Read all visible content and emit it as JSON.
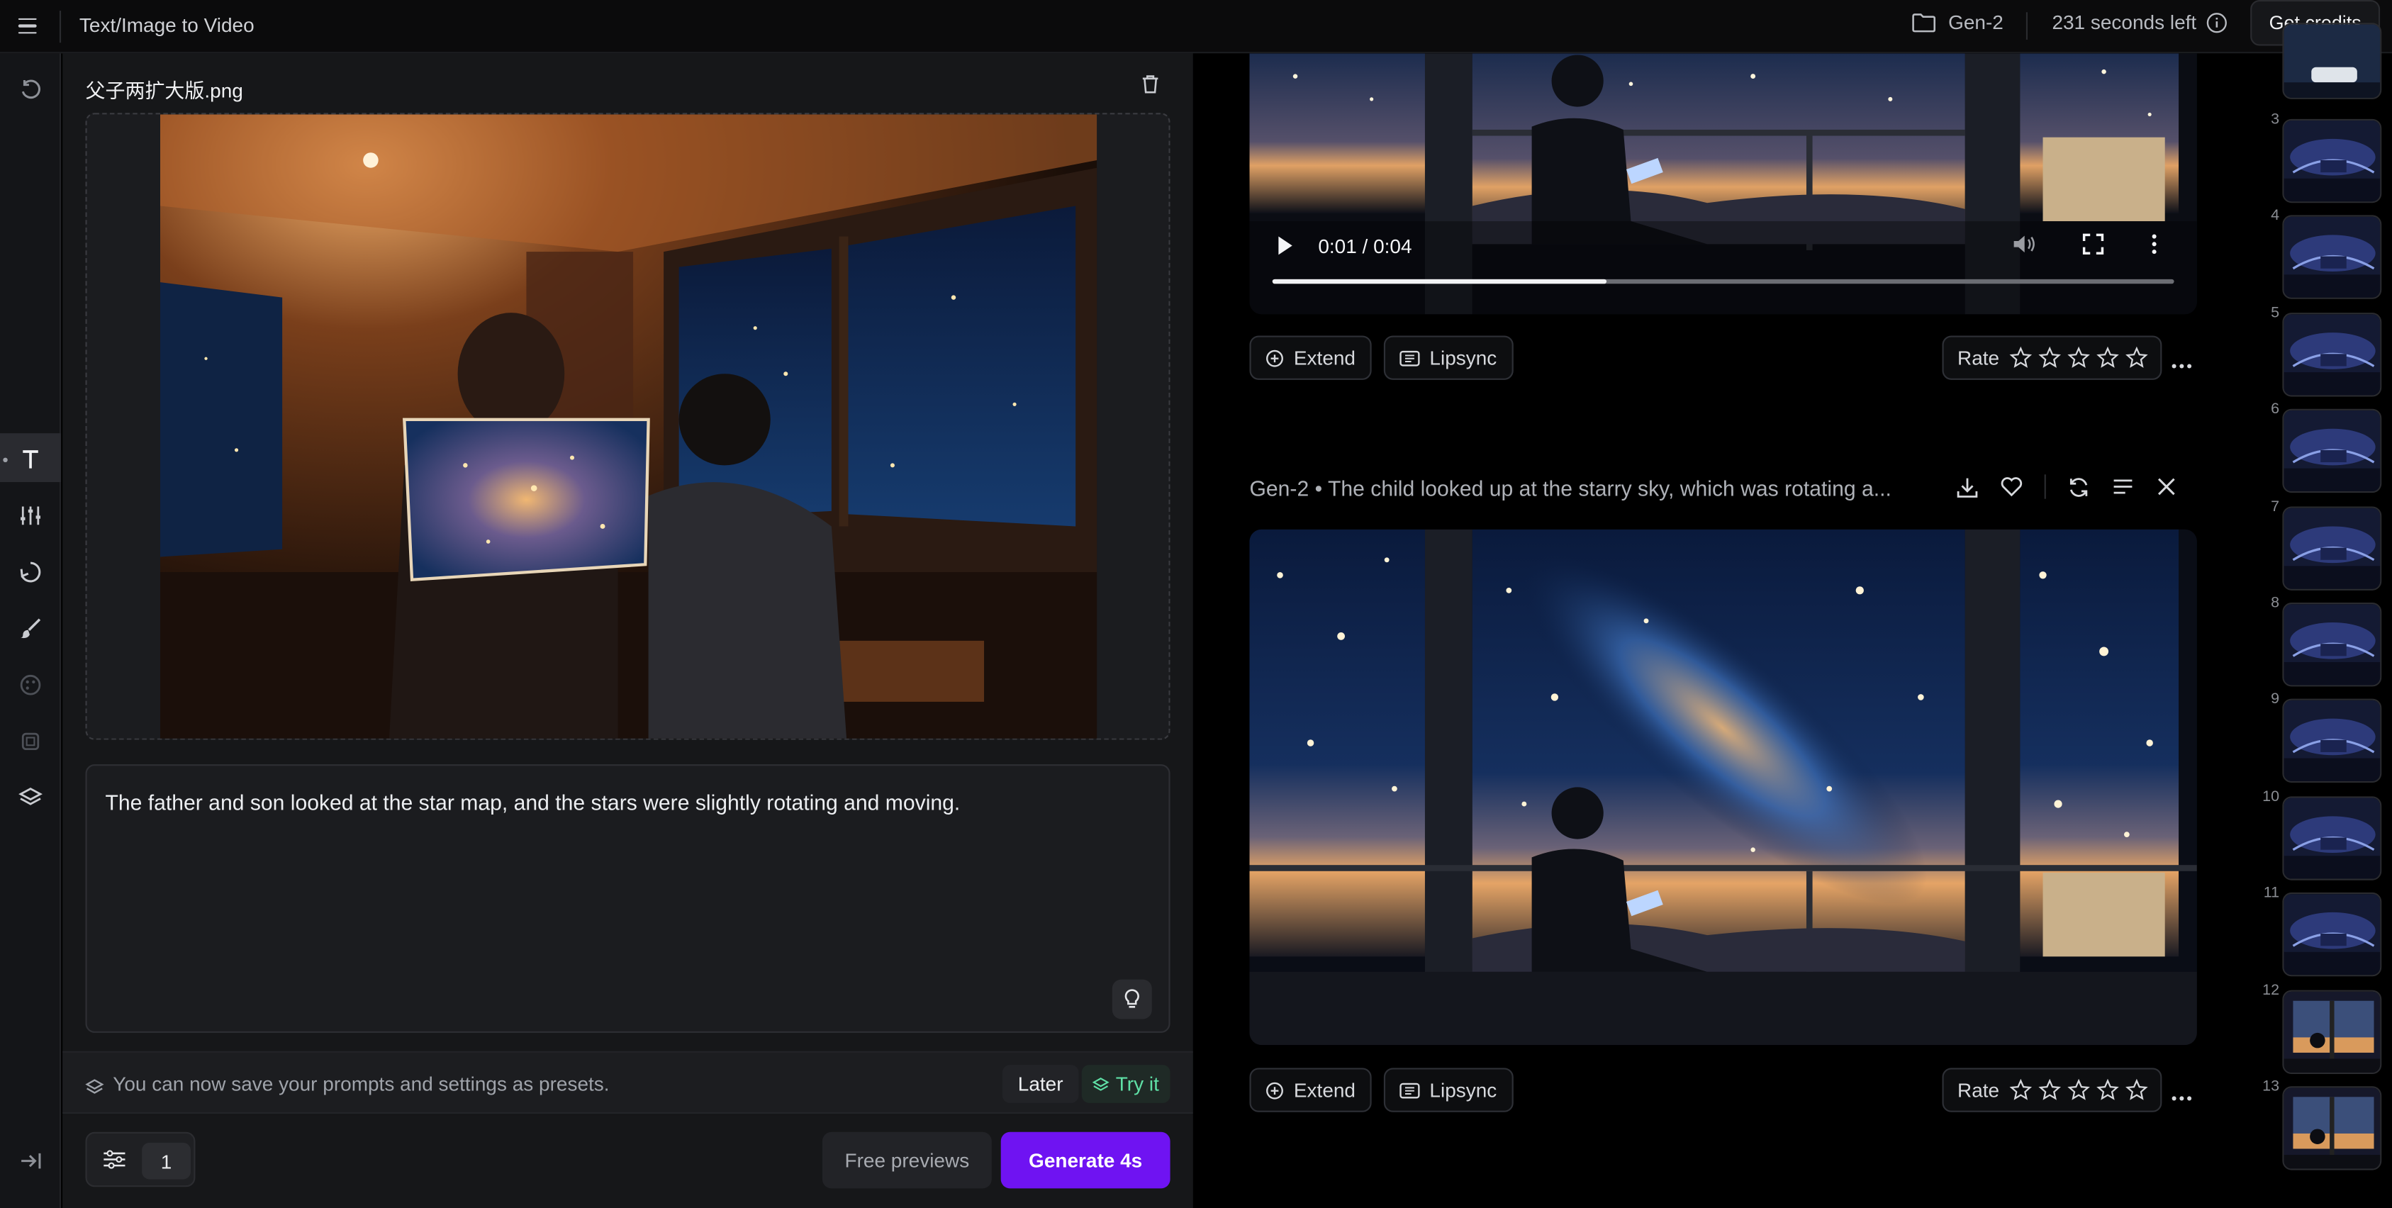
{
  "topbar": {
    "app_title": "Text/Image to Video",
    "project": "Gen-2",
    "seconds_left": "231 seconds left",
    "credits_button": "Get credits"
  },
  "editor": {
    "file_name": "父子两扩大版.png",
    "prompt_text": "The father and son looked at the star map, and the stars were slightly rotating and moving.",
    "presets_notice": "You can now save your prompts and settings as presets.",
    "later_button": "Later",
    "try_button": "Try it",
    "count": "1",
    "free_previews_button": "Free previews",
    "generate_button": "Generate 4s"
  },
  "results": [
    {
      "timecode": "0:01 / 0:04",
      "progress": 0.37,
      "extend_label": "Extend",
      "lipsync_label": "Lipsync",
      "rate_label": "Rate"
    },
    {
      "title": "Gen-2 • The child looked up at the starry sky, which was rotating a...",
      "extend_label": "Extend",
      "lipsync_label": "Lipsync",
      "rate_label": "Rate"
    }
  ],
  "thumbnails": [
    "3",
    "4",
    "5",
    "6",
    "7",
    "8",
    "9",
    "10",
    "11",
    "12",
    "13"
  ],
  "colors": {
    "accent": "#6f13f2",
    "try_it": "#5fe0a6"
  }
}
